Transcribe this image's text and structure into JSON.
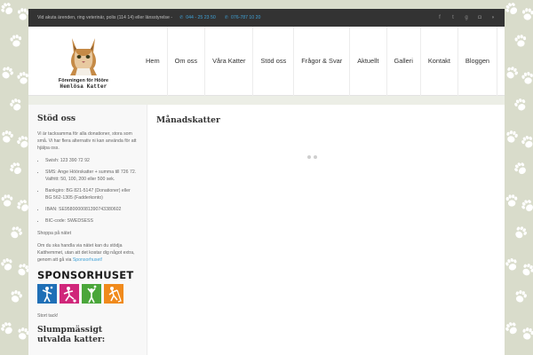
{
  "topbar": {
    "notice": "Vid akuta ärenden, ring veterinär, polis (114 14) eller länsstyrelse -",
    "phone1": "044 - 25 23 50",
    "phone2": "076-787 10 20",
    "social_icons": [
      "facebook-icon",
      "twitter-icon",
      "google-plus-icon",
      "instagram-icon",
      "rss-icon"
    ]
  },
  "logo": {
    "line1": "Föreningen för Hööre",
    "line2": "Hemlösa Katter"
  },
  "nav": {
    "items": [
      {
        "label": "Hem"
      },
      {
        "label": "Om oss"
      },
      {
        "label": "Våra Katter"
      },
      {
        "label": "Stöd oss"
      },
      {
        "label": "Frågor & Svar"
      },
      {
        "label": "Aktuellt"
      },
      {
        "label": "Galleri"
      },
      {
        "label": "Kontakt"
      },
      {
        "label": "Bloggen"
      }
    ]
  },
  "sidebar": {
    "title": "Stöd oss",
    "intro": "Vi är tacksamma för alla donationer, stora som små. Vi har flera alternativ ni kan använda för att hjälpa oss.",
    "items": [
      "Swish: 123 390 72 92",
      "SMS: Ange Höörskatter + summa till 726 72. Valfritt: 50, 100, 200 eller 500 sek.",
      "Bankgiro: BG 821-5147 (Donationer) eller BG 562-1305 (Fadderkonto)",
      "IBAN: SE9580000081390743380602",
      "BIC-code: SWEDSESS"
    ],
    "shop_title": "Shoppa på nätet",
    "shop_text": "Om du ska handla via nätet kan du stödja Katthemmet, utan att det kostar dig något extra, genom att gå via",
    "shop_link": "Sponsorhuset!",
    "sponsor_brand": "SPONSORHUSET",
    "thanks": "Stort tack!",
    "next_title": "Slumpmässigt utvalda katter:"
  },
  "main": {
    "title": "Månadskatter"
  },
  "colors": {
    "accent": "#3fa1d6",
    "topbar": "#333333",
    "tile_blue": "#1f6fb6",
    "tile_pink": "#d0267a",
    "tile_green": "#4aa63a",
    "tile_orange": "#f08a1c"
  }
}
